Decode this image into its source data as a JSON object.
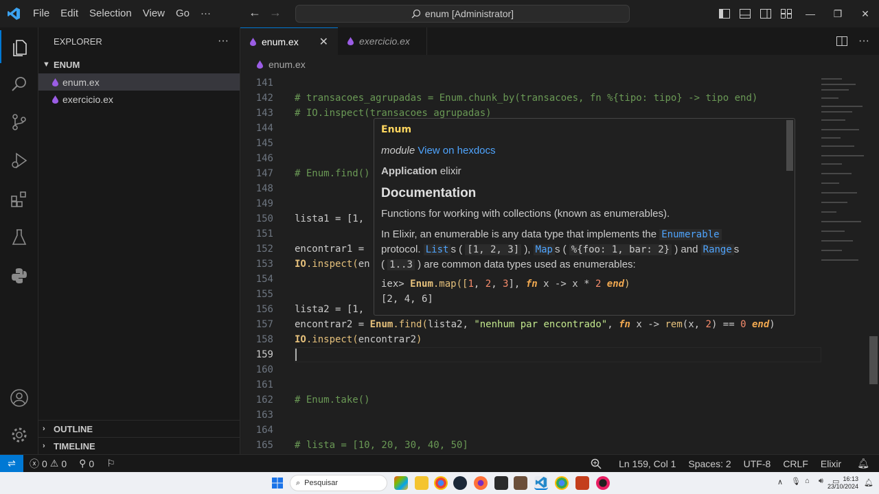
{
  "menu": [
    "File",
    "Edit",
    "Selection",
    "View",
    "Go"
  ],
  "command_center": "enum [Administrator]",
  "sidebar": {
    "title": "EXPLORER",
    "folder": "ENUM",
    "files": [
      {
        "name": "enum.ex",
        "selected": true
      },
      {
        "name": "exercicio.ex",
        "selected": false
      }
    ],
    "outline": "OUTLINE",
    "timeline": "TIMELINE"
  },
  "tabs": [
    {
      "label": "enum.ex",
      "active": true
    },
    {
      "label": "exercicio.ex",
      "active": false
    }
  ],
  "breadcrumb": "enum.ex",
  "code": {
    "l141": "141",
    "l142": "142",
    "t142": "# transacoes_agrupadas = Enum.chunk_by(transacoes, fn %{tipo: tipo} -> tipo end)",
    "l143": "143",
    "t143": "# IO.inspect(transacoes_agrupadas)",
    "l144": "144",
    "l145": "145",
    "l146": "146",
    "l147": "147",
    "t147": "# Enum.find()",
    "l148": "148",
    "l149": "149",
    "l150": "150",
    "t150a": "lista1",
    "t150b": " = [1,",
    "l151": "151",
    "l152": "152",
    "t152a": "encontrar1",
    "t152b": " =",
    "l153": "153",
    "t153a": "IO",
    "t153b": ".inspect(",
    "t153c": "en",
    "l154": "154",
    "l155": "155",
    "l156": "156",
    "t156a": "lista2",
    "t156b": " = [1,",
    "l157": "157",
    "t157a": "encontrar2",
    "t157b": " = ",
    "t157c": "Enum",
    "t157d": ".find(",
    "t157e": "lista2",
    "t157f": ", ",
    "t157g": "\"nenhum par encontrado\"",
    "t157h": ", ",
    "t157i": "fn",
    "t157j": " x -> ",
    "t157k": "rem",
    "t157l": "(x, ",
    "t157m": "2",
    "t157n": ") == ",
    "t157o": "0",
    "t157p": " end",
    "t157q": ")",
    "l158": "158",
    "t158a": "IO",
    "t158b": ".inspect(",
    "t158c": "encontrar2",
    "t158d": ")",
    "l159": "159",
    "l160": "160",
    "l161": "161",
    "l162": "162",
    "t162": "# Enum.take()",
    "l163": "163",
    "l164": "164",
    "l165": "165",
    "t165": "# lista = [10, 20, 30, 40, 50]"
  },
  "hover": {
    "title": "Enum",
    "module_word": "module",
    "hexdocs_link": "View on hexdocs",
    "application_label": "Application",
    "application_value": "elixir",
    "doc_heading": "Documentation",
    "p1": "Functions for working with collections (known as enumerables).",
    "p2a": "In Elixir, an enumerable is any data type that implements the",
    "p2_enumerable": "Enumerable",
    "p2b": "protocol.",
    "p2_list": "List",
    "p2_s1": "s (",
    "p2_list_ex": "[1, 2, 3]",
    "p2_s2": "),",
    "p2_map": "Map",
    "p2_s3": "s (",
    "p2_map_ex": "%{foo: 1, bar: 2}",
    "p2_s4": ") and",
    "p2_range": "Range",
    "p2_s5": "s",
    "p2_s6": "(",
    "p2_range_ex": "1..3",
    "p2_s7": ") are common data types used as enumerables:",
    "ex1_prompt": "iex> ",
    "ex1_mod": "Enum",
    "ex1_a": ".map([",
    "ex1_n1": "1",
    "ex1_c1": ", ",
    "ex1_n2": "2",
    "ex1_c2": ", ",
    "ex1_n3": "3",
    "ex1_b": "], ",
    "ex1_fn": "fn",
    "ex1_c": " x -> x * ",
    "ex1_n4": "2",
    "ex1_end": " end",
    "ex1_close": ")",
    "ex2": "[2, 4, 6]"
  },
  "status": {
    "errors": "0",
    "warnings": "0",
    "ports": "0",
    "position": "Ln 159, Col 1",
    "spaces": "Spaces: 2",
    "encoding": "UTF-8",
    "eol": "CRLF",
    "language": "Elixir"
  },
  "taskbar": {
    "search_placeholder": "Pesquisar",
    "time": "16:13",
    "date": "23/10/2024"
  },
  "colors": {
    "accent": "#0078d4",
    "elixir_drop": "#9b5de5"
  }
}
